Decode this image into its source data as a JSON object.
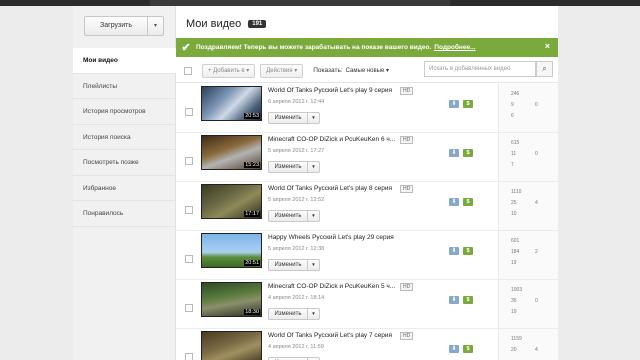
{
  "sidebar": {
    "upload_label": "Загрузить",
    "items": [
      "Мои видео",
      "Плейлисты",
      "История просмотров",
      "История поиска",
      "Посмотреть позже",
      "Избранное",
      "Понравилось"
    ]
  },
  "header": {
    "title": "Мои видео",
    "count": "191"
  },
  "banner": {
    "text": "Поздравляем! Теперь вы можете зарабатывать на показе вашего видео.",
    "link": "Подробнее...",
    "close": "×"
  },
  "toolbar": {
    "add_label": "+ Добавить в ▾",
    "actions_label": "Действия ▾",
    "show_label": "Показать:",
    "sort_label": "Самые новые ▾",
    "search_placeholder": "Искать в добавленных видео"
  },
  "videos": [
    {
      "title": "World Of Tanks Русский Let's play 9 серия",
      "hd": "HD",
      "date": "6 апреля 2012 г. 12:44",
      "duration": "20:53",
      "edit": "Изменить",
      "views": "246",
      "likes": "9",
      "comments": "6",
      "dislikes": "0"
    },
    {
      "title": "Minecraft CO-OP DiZick и PcuKeuKen 6 ч...",
      "hd": "HD",
      "date": "5 апреля 2012 г. 17:27",
      "duration": "15:23",
      "edit": "Изменить",
      "views": "615",
      "likes": "11",
      "comments": "7",
      "dislikes": "0"
    },
    {
      "title": "World Of Tanks Русский Let's play 8 серия",
      "hd": "HD",
      "date": "5 апреля 2012 г. 12:52",
      "duration": "17:17",
      "edit": "Изменить",
      "views": "1110",
      "likes": "25",
      "comments": "10",
      "dislikes": "4"
    },
    {
      "title": "Happy Wheels Русский Let's play 29 серия",
      "hd": "",
      "date": "5 апреля 2012 г. 12:38",
      "duration": "20:51",
      "edit": "Изменить",
      "views": "601",
      "likes": "184",
      "comments": "19",
      "dislikes": "2"
    },
    {
      "title": "Minecraft CO-OP DiZick и PcuKeuKen 5 ч...",
      "hd": "HD",
      "date": "4 апреля 2012 г. 18:14",
      "duration": "18:30",
      "edit": "Изменить",
      "views": "1003",
      "likes": "35",
      "comments": "19",
      "dislikes": "0"
    },
    {
      "title": "World Of Tanks Русский Let's play 7 серия",
      "hd": "HD",
      "date": "4 апреля 2012 г. 11:59",
      "duration": "",
      "edit": "Изменить",
      "views": "1159",
      "likes": "20",
      "comments": "",
      "dislikes": "4"
    }
  ],
  "icons": {
    "check": "checkmark-icon",
    "download": "download-icon",
    "money": "monetize-icon",
    "search": "search-icon"
  }
}
